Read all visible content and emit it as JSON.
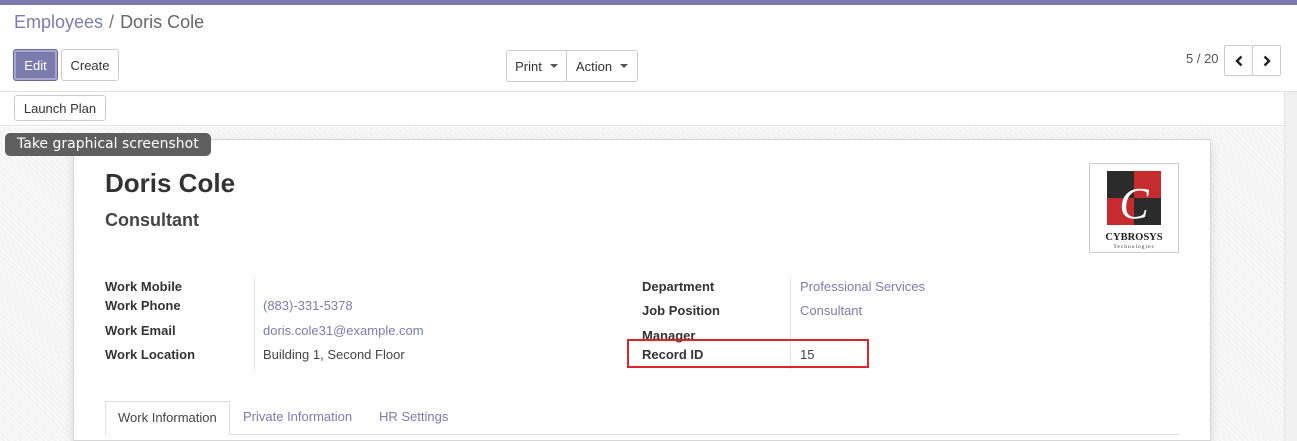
{
  "breadcrumb": {
    "parent": "Employees",
    "separator": "/",
    "current": "Doris Cole"
  },
  "toolbar": {
    "edit_label": "Edit",
    "create_label": "Create",
    "print_label": "Print",
    "action_label": "Action"
  },
  "pager": {
    "value": "5 / 20"
  },
  "statusbar": {
    "launch_plan_label": "Launch Plan"
  },
  "tooltip": {
    "text": "Take graphical screenshot"
  },
  "employee": {
    "name": "Doris Cole",
    "job_title": "Consultant"
  },
  "logo": {
    "brand": "CYBROSYS",
    "sub": "Technologies",
    "letter": "C",
    "colors": {
      "red": "#c62b2e",
      "dark": "#2b2b2b"
    }
  },
  "fields_left": [
    {
      "label": "Work Mobile",
      "value": ""
    },
    {
      "label": "Work Phone",
      "value": "(883)-331-5378"
    },
    {
      "label": "Work Email",
      "value": "doris.cole31@example.com"
    },
    {
      "label": "Work Location",
      "value": "Building 1, Second Floor"
    }
  ],
  "fields_right": [
    {
      "label": "Department",
      "value": "Professional Services"
    },
    {
      "label": "Job Position",
      "value": "Consultant"
    },
    {
      "label": "Manager",
      "value": ""
    },
    {
      "label": "Record ID",
      "value": "15"
    }
  ],
  "tabs": [
    {
      "label": "Work Information",
      "active": true
    },
    {
      "label": "Private Information",
      "active": false
    },
    {
      "label": "HR Settings",
      "active": false
    }
  ],
  "colors": {
    "accent": "#7c7bad",
    "highlight": "#d9262b"
  }
}
